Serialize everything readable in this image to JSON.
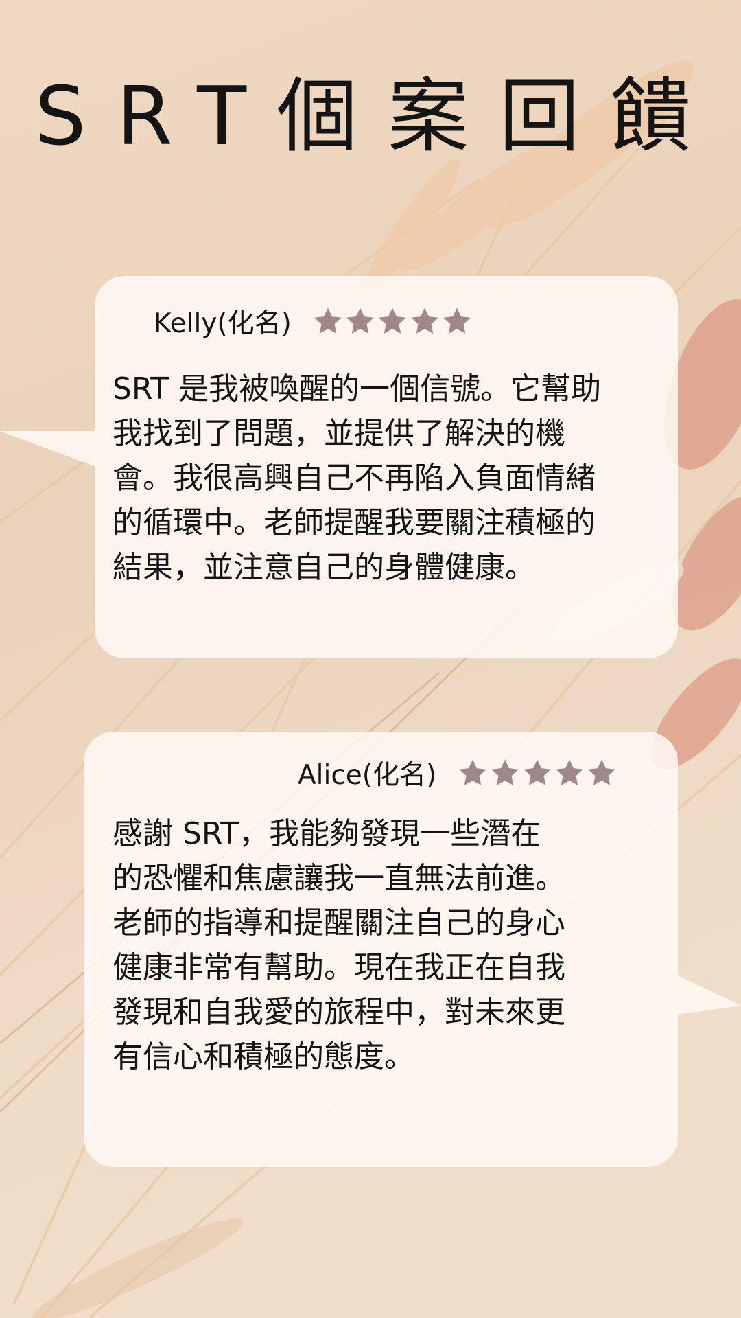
{
  "title": "SRT個案回饋",
  "colors": {
    "background": "#ecd5bf",
    "card": "#fffaf7",
    "star": "#a08886",
    "text": "#141414"
  },
  "reviews": [
    {
      "name": "Kelly(化名)",
      "rating": 5,
      "text": "SRT 是我被喚醒的一個信號。它幫助\n我找到了問題，並提供了解決的機\n會。我很高興自己不再陷入負面情緒\n的循環中。老師提醒我要關注積極的\n結果，並注意自己的身體健康。"
    },
    {
      "name": "Alice(化名)",
      "rating": 5,
      "text": "感謝 SRT，我能夠發現一些潛在\n的恐懼和焦慮讓我一直無法前進。\n老師的指導和提醒關注自己的身心\n健康非常有幫助。現在我正在自我\n發現和自我愛的旅程中，對未來更\n有信心和積極的態度。"
    }
  ]
}
